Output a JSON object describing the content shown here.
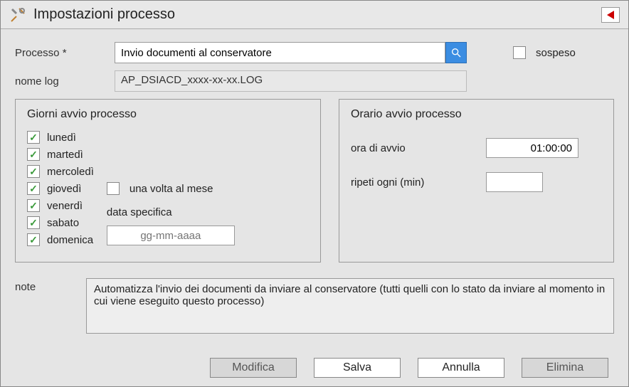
{
  "title": "Impostazioni processo",
  "fields": {
    "processo_label": "Processo *",
    "processo_value": "Invio documenti al conservatore",
    "nome_log_label": "nome log",
    "nome_log_value": "AP_DSIACD_xxxx-xx-xx.LOG",
    "sospeso_label": "sospeso",
    "sospeso_checked": false
  },
  "days_panel": {
    "title": "Giorni avvio processo",
    "days": [
      {
        "label": "lunedì",
        "checked": true
      },
      {
        "label": "martedì",
        "checked": true
      },
      {
        "label": "mercoledì",
        "checked": true
      },
      {
        "label": "giovedì",
        "checked": true
      },
      {
        "label": "venerdì",
        "checked": true
      },
      {
        "label": "sabato",
        "checked": true
      },
      {
        "label": "domenica",
        "checked": true
      }
    ],
    "once_month_label": "una volta al mese",
    "once_month_checked": false,
    "data_specifica_label": "data specifica",
    "data_specifica_placeholder": "gg-mm-aaaa"
  },
  "time_panel": {
    "title": "Orario avvio processo",
    "ora_label": "ora di avvio",
    "ora_value": "01:00:00",
    "ripeti_label": "ripeti ogni (min)",
    "ripeti_value": ""
  },
  "note": {
    "label": "note",
    "value": "Automatizza l'invio dei documenti da inviare al conservatore (tutti quelli con lo stato da inviare al momento in cui viene eseguito questo processo)"
  },
  "buttons": {
    "modifica": "Modifica",
    "salva": "Salva",
    "annulla": "Annulla",
    "elimina": "Elimina"
  }
}
